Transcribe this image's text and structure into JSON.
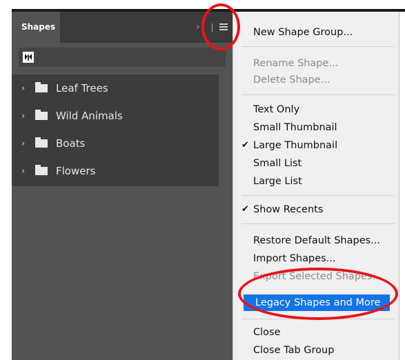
{
  "panel": {
    "tab_label": "Shapes",
    "collapse_glyph": "›",
    "groups": [
      {
        "label": "Leaf Trees"
      },
      {
        "label": "Wild Animals"
      },
      {
        "label": "Boats"
      },
      {
        "label": "Flowers"
      }
    ]
  },
  "menu": {
    "items": [
      {
        "label": "New Shape Group...",
        "disabled": false
      },
      {
        "label": "Rename Shape...",
        "disabled": true
      },
      {
        "label": "Delete Shape...",
        "disabled": true
      },
      {
        "label": "Text Only",
        "disabled": false
      },
      {
        "label": "Small Thumbnail",
        "disabled": false
      },
      {
        "label": "Large Thumbnail",
        "disabled": false,
        "checked": true
      },
      {
        "label": "Small List",
        "disabled": false
      },
      {
        "label": "Large List",
        "disabled": false
      },
      {
        "label": "Show Recents",
        "disabled": false,
        "checked": true
      },
      {
        "label": "Restore Default Shapes...",
        "disabled": false
      },
      {
        "label": "Import Shapes...",
        "disabled": false
      },
      {
        "label": "Export Selected Shapes...",
        "disabled": true
      },
      {
        "label": "Legacy Shapes and More",
        "highlighted": true
      },
      {
        "label": "Close",
        "disabled": false
      },
      {
        "label": "Close Tab Group",
        "disabled": false
      }
    ]
  },
  "colors": {
    "panel_bg": "#535353",
    "menu_bg": "#f0f0f0",
    "highlight": "#1473e6",
    "annotation": "#e8141c"
  },
  "icons": {
    "check": "✔",
    "chevron": "›"
  }
}
